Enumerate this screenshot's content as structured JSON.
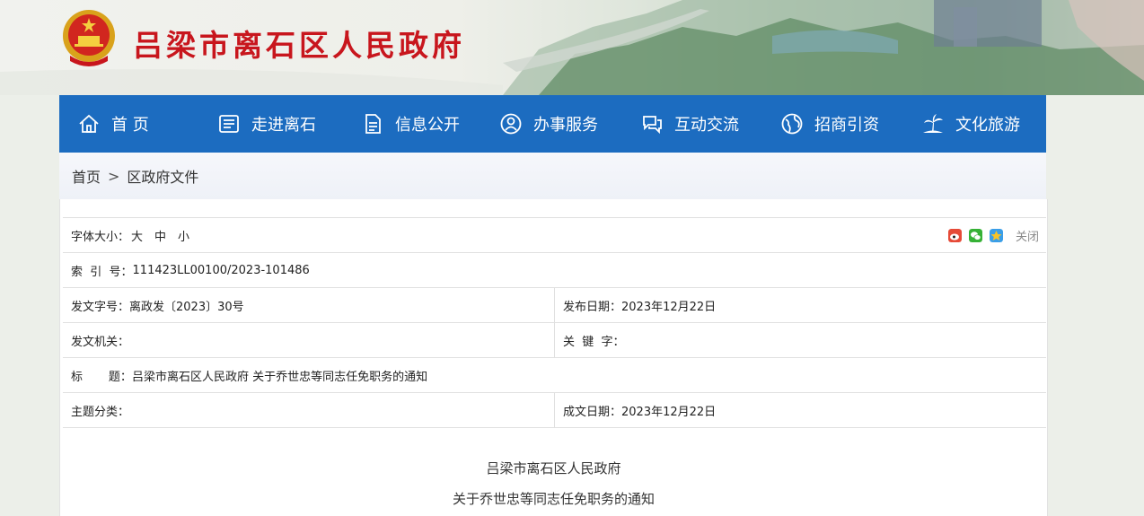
{
  "header": {
    "site_title": "吕梁市离石区人民政府",
    "title_color": "#c8161d"
  },
  "nav": {
    "bg_color": "#1c6cc0",
    "items": [
      {
        "label": "首 页",
        "icon": "home-icon"
      },
      {
        "label": "走进离石",
        "icon": "book-icon"
      },
      {
        "label": "信息公开",
        "icon": "document-icon"
      },
      {
        "label": "办事服务",
        "icon": "user-service-icon"
      },
      {
        "label": "互动交流",
        "icon": "chat-icon"
      },
      {
        "label": "招商引资",
        "icon": "globe-icon"
      },
      {
        "label": "文化旅游",
        "icon": "palm-tree-icon"
      }
    ]
  },
  "breadcrumb": {
    "home": "首页",
    "separator": ">",
    "current": "区政府文件"
  },
  "toolbar": {
    "font_size_label": "字体大小：",
    "font_sizes": [
      "大",
      "中",
      "小"
    ],
    "share_icons": [
      "weibo-icon",
      "wechat-icon",
      "qzone-icon"
    ],
    "close_label": "关闭"
  },
  "meta": {
    "index_label": "索  引  号：",
    "index_value": "111423LL00100/2023-101486",
    "doc_no_label": "发文字号：",
    "doc_no_value": "离政发〔2023〕30号",
    "publish_date_label": "发布日期：",
    "publish_date_value": "2023年12月22日",
    "issuer_label": "发文机关：",
    "issuer_value": "",
    "keywords_label": "关  键  字：",
    "keywords_value": "",
    "title_label": "标       题：",
    "title_value": "吕梁市离石区人民政府 关于乔世忠等同志任免职务的通知",
    "topic_label": "主题分类：",
    "topic_value": "",
    "created_date_label": "成文日期：",
    "created_date_value": "2023年12月22日"
  },
  "document": {
    "issuer_line": "吕梁市离石区人民政府",
    "title_line": "关于乔世忠等同志任免职务的通知"
  }
}
